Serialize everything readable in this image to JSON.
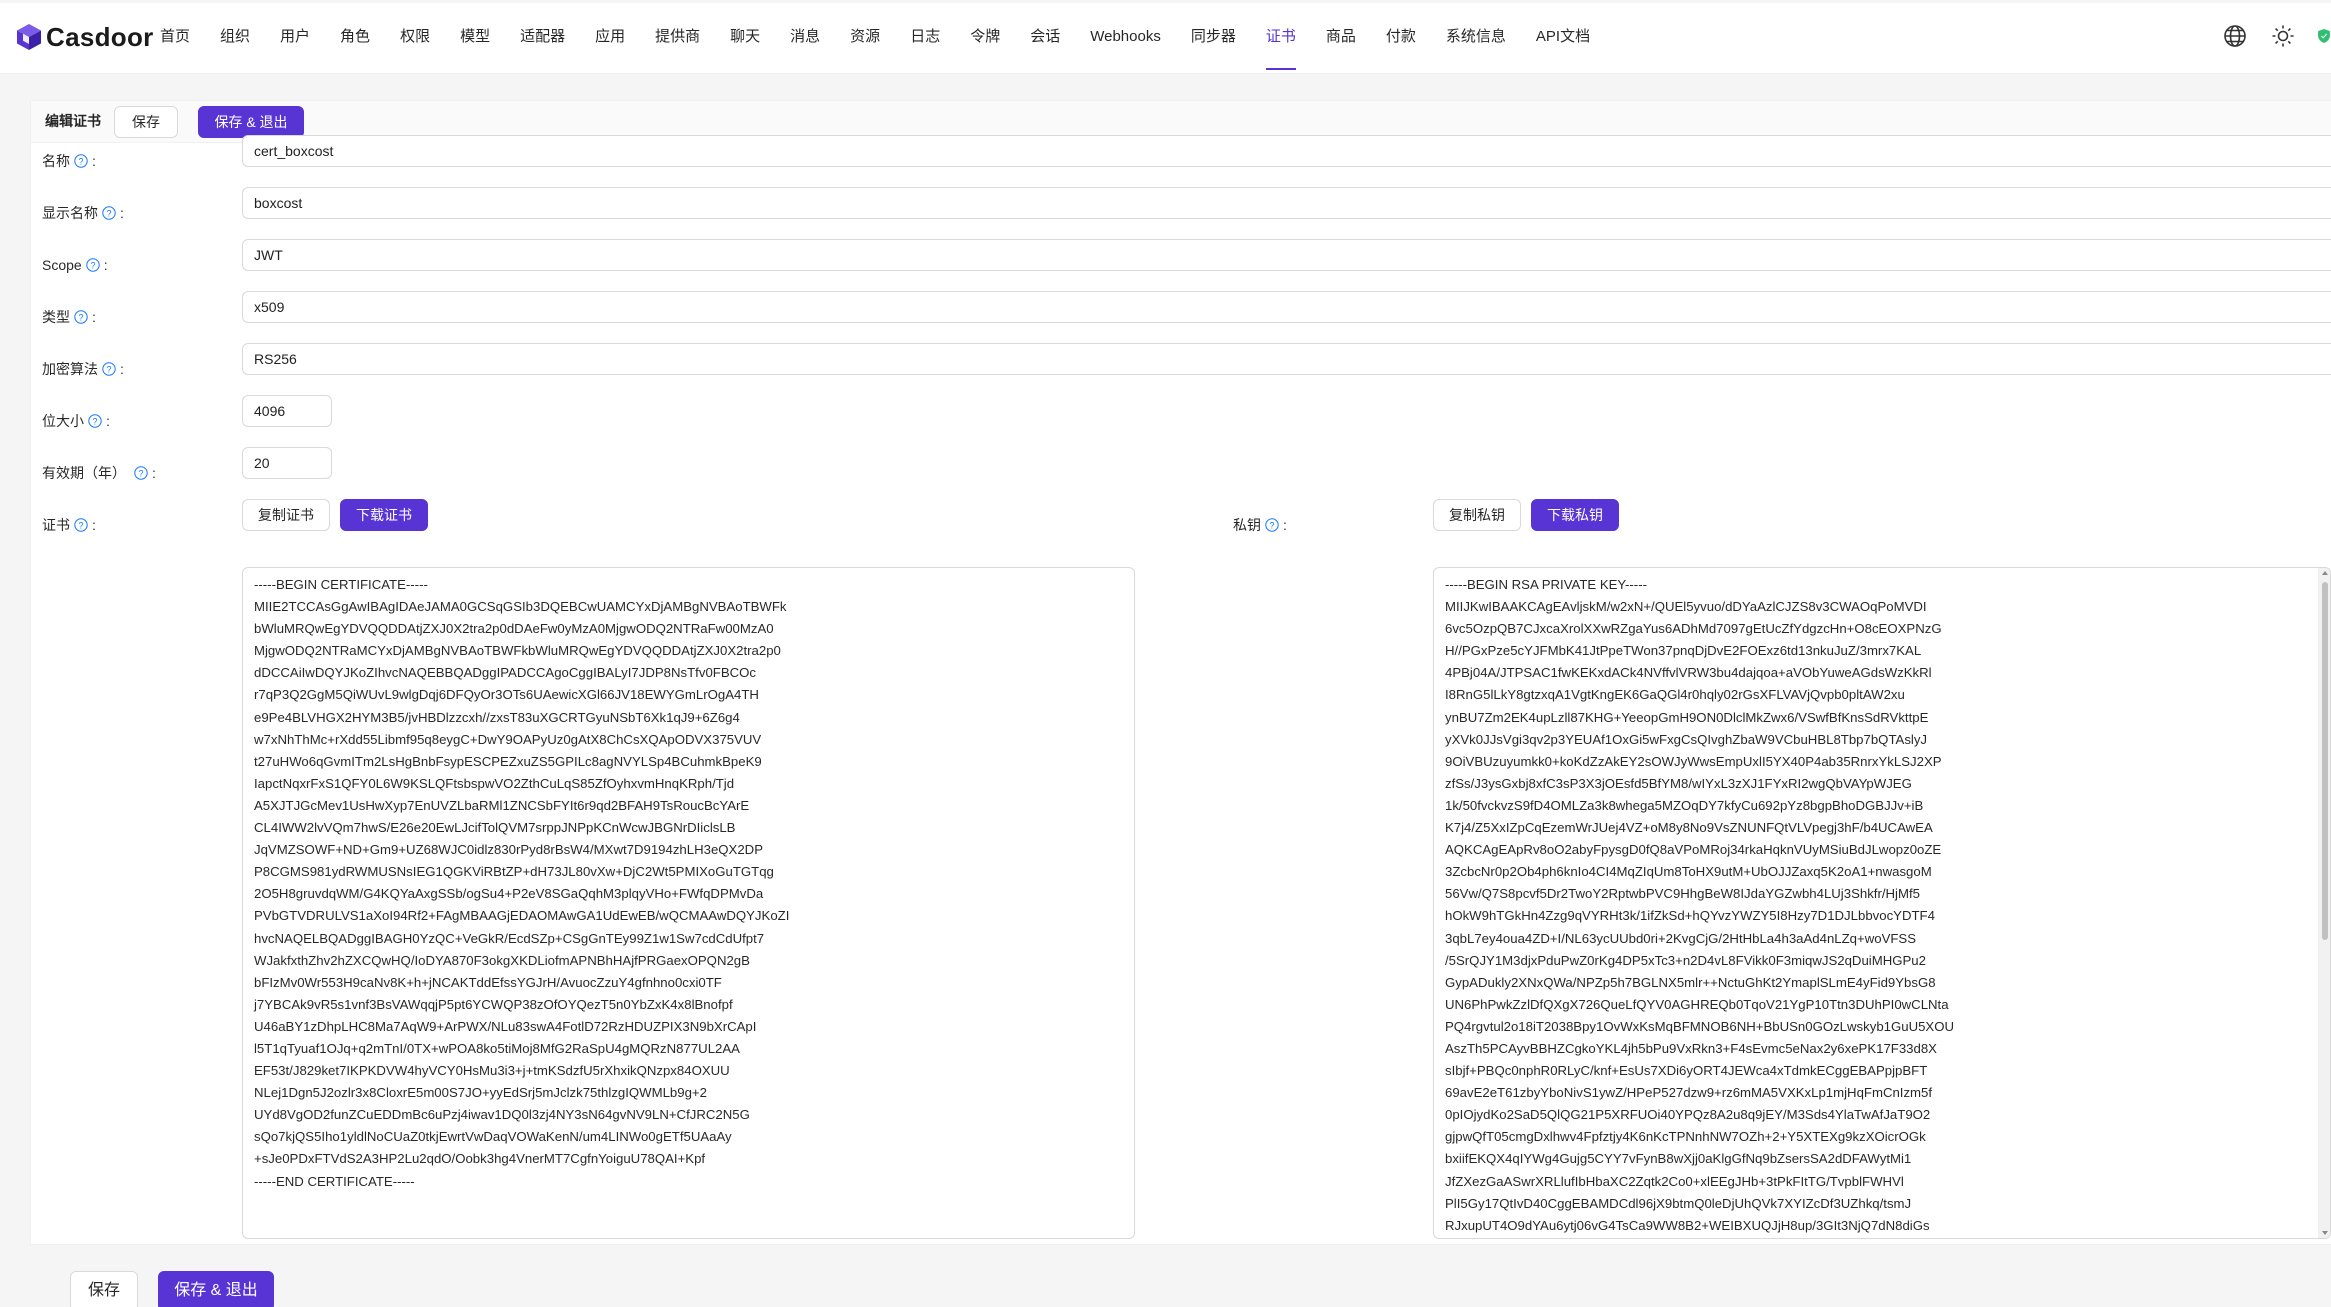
{
  "brand": {
    "name": "Casdoor",
    "accent": "#5734d3"
  },
  "nav": {
    "items": [
      {
        "label": "首页"
      },
      {
        "label": "组织"
      },
      {
        "label": "用户"
      },
      {
        "label": "角色"
      },
      {
        "label": "权限"
      },
      {
        "label": "模型"
      },
      {
        "label": "适配器"
      },
      {
        "label": "应用"
      },
      {
        "label": "提供商"
      },
      {
        "label": "聊天"
      },
      {
        "label": "消息"
      },
      {
        "label": "资源"
      },
      {
        "label": "日志"
      },
      {
        "label": "令牌"
      },
      {
        "label": "会话"
      },
      {
        "label": "Webhooks"
      },
      {
        "label": "同步器"
      },
      {
        "label": "证书"
      },
      {
        "label": "商品"
      },
      {
        "label": "付款"
      },
      {
        "label": "系统信息"
      },
      {
        "label": "API文档"
      }
    ],
    "active": "证书",
    "right_icons": [
      "globe-icon",
      "sun-icon",
      "shield-icon"
    ]
  },
  "editor": {
    "title": "编辑证书",
    "save_label": "保存",
    "save_exit_label": "保存 & 退出"
  },
  "fields": {
    "name": {
      "label": "名称",
      "value": "cert_boxcost"
    },
    "display_name": {
      "label": "显示名称",
      "value": "boxcost"
    },
    "scope": {
      "label": "Scope",
      "value": "JWT"
    },
    "type": {
      "label": "类型",
      "value": "x509"
    },
    "crypto_algorithm": {
      "label": "加密算法",
      "value": "RS256"
    },
    "bit_size": {
      "label": "位大小",
      "value": "4096"
    },
    "expire_in_years": {
      "label": "有效期（年）",
      "value": "20"
    }
  },
  "certificate": {
    "label": "证书",
    "copy_label": "复制证书",
    "download_label": "下载证书",
    "text": "-----BEGIN CERTIFICATE-----\nMIIE2TCCAsGgAwIBAgIDAeJAMA0GCSqGSIb3DQEBCwUAMCYxDjAMBgNVBAoTBWFk\nbWluMRQwEgYDVQQDDAtjZXJ0X2tra2p0dDAeFw0yMzA0MjgwODQ2NTRaFw00MzA0\nMjgwODQ2NTRaMCYxDjAMBgNVBAoTBWFkbWluMRQwEgYDVQQDDAtjZXJ0X2tra2p0\ndDCCAiIwDQYJKoZIhvcNAQEBBQADggIPADCCAgoCggIBALyI7JDP8NsTfv0FBCOc\nr7qP3Q2GgM5QiWUvL9wlgDqj6DFQyOr3OTs6UAewicXGl66JV18EWYGmLrOgA4TH\ne9Pe4BLVHGX2HYM3B5/jvHBDlzzcxh//zxsT83uXGCRTGyuNSbT6Xk1qJ9+6Z6g4\nw7xNhThMc+rXdd55Libmf95q8eygC+DwY9OAPyUz0gAtX8ChCsXQApODVX375VUV\nt27uHWo6qGvmITm2LsHgBnbFsypESCPEZxuZS5GPILc8agNVYLSp4BCuhmkBpeK9\nIapctNqxrFxS1QFY0L6W9KSLQFtsbspwVO2ZthCuLqS85ZfOyhxvmHnqKRph/Tjd\nA5XJTJGcMev1UsHwXyp7EnUVZLbaRMl1ZNCSbFYIt6r9qd2BFAH9TsRoucBcYArE\nCL4IWW2lvVQm7hwS/E26e20EwLJcifTolQVM7srppJNPpKCnWcwJBGNrDIiclsLB\nJqVMZSOWF+ND+Gm9+UZ68WJC0idlz830rPyd8rBsW4/MXwt7D9194zhLH3eQX2DP\nP8CGMS981ydRWMUSNsIEG1QGKViRBtZP+dH73JL80vXw+DjC2Wt5PMIXoGuTGTqg\n2O5H8gruvdqWM/G4KQYaAxgSSb/ogSu4+P2eV8SGaQqhM3plqyVHo+FWfqDPMvDa\nPVbGTVDRULVS1aXoI94Rf2+FAgMBAAGjEDAOMAwGA1UdEwEB/wQCMAAwDQYJKoZI\nhvcNAQELBQADggIBAGH0YzQC+VeGkR/EcdSZp+CSgGnTEy99Z1w1Sw7cdCdUfpt7\nWJakfxthZhv2hZXCQwHQ/IoDYA870F3okgXKDLiofmAPNBhHAjfPRGaexOPQN2gB\nbFIzMv0Wr553H9caNv8K+h+jNCAKTddEfssYGJrH/AvuocZzuY4gfnhno0cxi0TF\nj7YBCAk9vR5s1vnf3BsVAWqqjP5pt6YCWQP38zOfOYQezT5n0YbZxK4x8lBnofpf\nU46aBY1zDhpLHC8Ma7AqW9+ArPWX/NLu83swA4FotlD72RzHDUZPIX3N9bXrCApI\nl5T1qTyuaf1OJq+q2mTnI/0TX+wPOA8ko5tiMoj8MfG2RaSpU4gMQRzN877UL2AA\nEF53t/J829ket7IKPKDVW4hyVCY0HsMu3i3+j+tmKSdzfU5rXhxikQNzpx84OXUU\nNLej1Dgn5J2ozlr3x8CloxrE5m00S7JO+yyEdSrj5mJclzk75thlzgIQWMLb9g+2\nUYd8VgOD2funZCuEDDmBc6uPzj4iwav1DQ0l3zj4NY3sN64gvNV9LN+CfJRC2N5G\nsQo7kjQS5Iho1yldlNoCUaZ0tkjEwrtVwDaqVOWaKenN/um4LINWo0gETf5UAaAy\n+sJe0PDxFTVdS2A3HP2Lu2qdO/Oobk3hg4VnerMT7CgfnYoiguU78QAI+Kpf\n-----END CERTIFICATE-----"
  },
  "private_key": {
    "label": "私钥",
    "copy_label": "复制私钥",
    "download_label": "下载私钥",
    "text": "-----BEGIN RSA PRIVATE KEY-----\nMIIJKwIBAAKCAgEAvljskM/w2xN+/QUEl5yvuo/dDYaAzlCJZS8v3CWAOqPoMVDI\n6vc5OzpQB7CJxcaXrolXXwRZgaYus6ADhMd7097gEtUcZfYdgzcHn+O8cEOXPNzG\nH//PGxPze5cYJFMbK41JtPpeTWon37pnqDjDvE2FOExz6td13nkuJuZ/3mrx7KAL\n4PBj04A/JTPSAC1fwKEKxdACk4NVffvlVRW3bu4dajqoa+aVObYuweAGdsWzKkRl\nI8RnG5lLkY8gtzxqA1VgtKngEK6GaQGl4r0hqly02rGsXFLVAVjQvpb0pltAW2xu\nynBU7Zm2EK4upLzll87KHG+YeeopGmH9ON0DlclMkZwx6/VSwfBfKnsSdRVkttpE\nyXVk0JJsVgi3qv2p3YEUAf1OxGi5wFxgCsQIvghZbaW9VCbuHBL8Tbp7bQTAslyJ\n9OiVBUzuyumkk0+koKdZzAkEY2sOWJyWwsEmpUxlI5YX40P4ab35RnrxYkLSJ2XP\nzfSs/J3ysGxbj8xfC3sP3X3jOEsfd5BfYM8/wIYxL3zXJ1FYxRI2wgQbVAYpWJEG\n1k/50fvckvzS9fD4OMLZa3k8whega5MZOqDY7kfyCu692pYz8bgpBhoDGBJJv+iB\nK7j4/Z5XxIZpCqEzemWrJUej4VZ+oM8y8No9VsZNUNFQtVLVpegj3hF/b4UCAwEA\nAQKCAgEApRv8oO2abyFpysgD0fQ8aVPoMRoj34rkaHqknVUyMSiuBdJLwopz0oZE\n3ZcbcNr0p2Ob4ph6knIo4CI4MqZIqUm8ToHX9utM+UbOJJZaxq5K2oA1+nwasgoM\n56Vw/Q7S8pcvf5Dr2TwoY2RptwbPVC9HhgBeW8IJdaYGZwbh4LUj3Shkfr/HjMf5\nhOkW9hTGkHn4Zzg9qVYRHt3k/1ifZkSd+hQYvzYWZY5I8Hzy7D1DJLbbvocYDTF4\n3qbL7ey4oua4ZD+I/NL63ycUUbd0ri+2KvgCjG/2HtHbLa4h3aAd4nLZq+woVFSS\n/5SrQJY1M3djxPduPwZ0rKg4DP5xTc3+n2D4vL8FVikk0F3miqwJS2qDuiMHGPu2\nGypADukly2XNxQWa/NPZp5h7BGLNX5mlr++NctuGhKt2YmaplSLmE4yFid9YbsG8\nUN6PhPwkZzlDfQXgX726QueLfQYV0AGHREQb0TqoV21YgP10Ttn3DUhPI0wCLNta\nPQ4rgvtul2o18iT2038Bpy1OvWxKsMqBFMNOB6NH+BbUSn0GOzLwskyb1GuU5XOU\nAszTh5PCAyvBBHZCgkoYKL4jh5bPu9VxRkn3+F4sEvmc5eNax2y6xePK17F33d8X\nsIbjf+PBQc0nphR0RLyC/knf+EsUs7XDi6yORT4JEWca4xTdmkECggEBAPpjpBFT\n69avE2eT61zbyYboNivS1ywZ/HPeP527dzw9+rz6mMA5VXKxLp1mjHqFmCnIzm5f\n0pIOjydKo2SaD5QlQG21P5XRFUOi40YPQz8A2u8q9jEY/M3Sds4YlaTwAfJaT9O2\ngjpwQfT05cmgDxlhwv4Fpfztjy4K6nKcTPNnhNW7OZh+2+Y5XTEXg9kzXOicrOGk\nbxiifEKQX4qIYWg4Gujg5CYY7vFynB8wXjj0aKlgGfNq9bZsersSA2dDFAWytMi1\nJfZXezGaASwrXRLlufIbHbaXC2Zqtk2Co0+xlEEgJHb+3tPkFItTG/TvpblFWHVl\nPlI5Gy17QtIvD40CggEBAMDCdl96jX9btmQ0leDjUhQVk7XYIZcDf3UZhkq/tsmJ\nRJxupUT4O9dYAu6ytj06vG4TsCa9WW8B2+WEIBXUQJjH8up/3GIt3NjQ7dN8diGs"
  }
}
